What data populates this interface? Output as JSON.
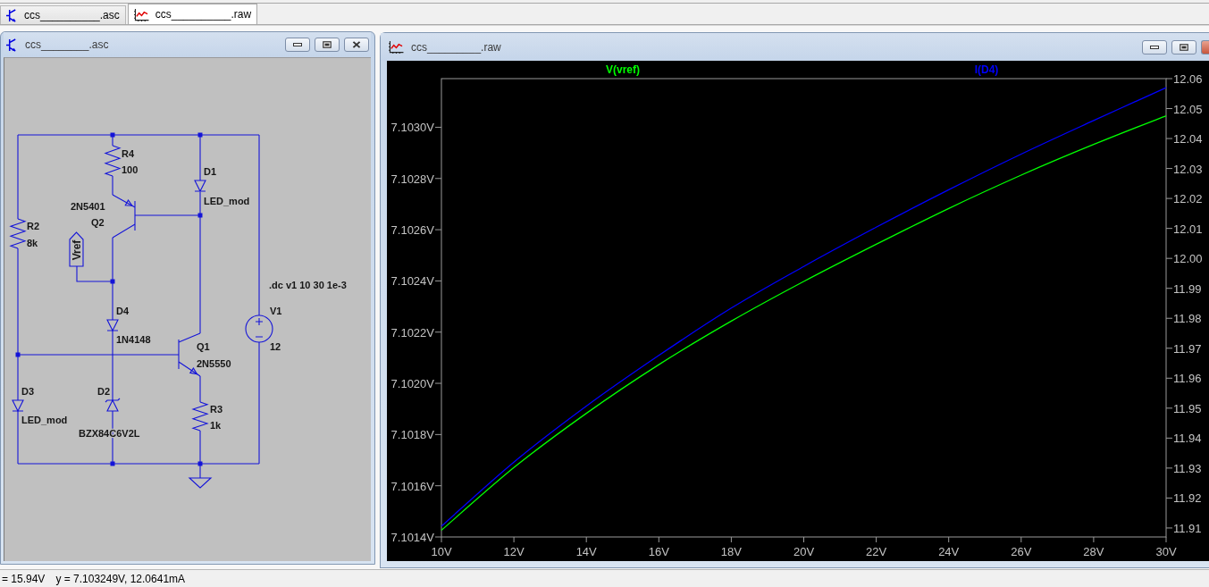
{
  "tabs": [
    {
      "kind": "schematic",
      "label": "ccs__________.asc",
      "selected": false
    },
    {
      "kind": "waveform",
      "label": "ccs__________.raw",
      "selected": true
    }
  ],
  "schematic_window": {
    "title": "ccs________.asc",
    "components": [
      {
        "kind": "resistor",
        "ref": "R4",
        "value": "100"
      },
      {
        "kind": "diode",
        "ref": "D1",
        "value": "LED_mod"
      },
      {
        "kind": "pnp",
        "ref": "Q2",
        "value": "2N5401"
      },
      {
        "kind": "resistor",
        "ref": "R2",
        "value": "8k"
      },
      {
        "kind": "diode",
        "ref": "D4",
        "value": "1N4148"
      },
      {
        "kind": "source",
        "ref": "V1",
        "value": "12"
      },
      {
        "kind": "npn",
        "ref": "Q1",
        "value": "2N5550"
      },
      {
        "kind": "diode",
        "ref": "D3",
        "value": "LED_mod"
      },
      {
        "kind": "zener",
        "ref": "D2",
        "value": "BZX84C6V2L"
      },
      {
        "kind": "resistor",
        "ref": "R3",
        "value": "1k"
      }
    ],
    "net_label": "Vref",
    "directive": ".dc v1 10 30 1e-3"
  },
  "plot_window": {
    "title": "ccs_________.raw",
    "chart_data": {
      "type": "line",
      "x": [
        10,
        12,
        14,
        16,
        18,
        20,
        22,
        24,
        26,
        28,
        30
      ],
      "xlim": [
        10,
        30
      ],
      "ylim": [
        7.1014,
        7.10319
      ],
      "y2lim": [
        11.907,
        12.06
      ],
      "xticks": [
        {
          "value": 10,
          "label": "10V"
        },
        {
          "value": 12,
          "label": "12V"
        },
        {
          "value": 14,
          "label": "14V"
        },
        {
          "value": 16,
          "label": "16V"
        },
        {
          "value": 18,
          "label": "18V"
        },
        {
          "value": 20,
          "label": "20V"
        },
        {
          "value": 22,
          "label": "22V"
        },
        {
          "value": 24,
          "label": "24V"
        },
        {
          "value": 26,
          "label": "26V"
        },
        {
          "value": 28,
          "label": "28V"
        },
        {
          "value": 30,
          "label": "30V"
        }
      ],
      "yticks": [
        {
          "value": 7.1014,
          "label": "7.1014V"
        },
        {
          "value": 7.1016,
          "label": "7.1016V"
        },
        {
          "value": 7.1018,
          "label": "7.1018V"
        },
        {
          "value": 7.102,
          "label": "7.1020V"
        },
        {
          "value": 7.1022,
          "label": "7.1022V"
        },
        {
          "value": 7.1024,
          "label": "7.1024V"
        },
        {
          "value": 7.1026,
          "label": "7.1026V"
        },
        {
          "value": 7.1028,
          "label": "7.1028V"
        },
        {
          "value": 7.103,
          "label": "7.1030V"
        }
      ],
      "y2ticks": [
        {
          "value": 11.91,
          "label": "11.91"
        },
        {
          "value": 11.92,
          "label": "11.92"
        },
        {
          "value": 11.93,
          "label": "11.93"
        },
        {
          "value": 11.94,
          "label": "11.94"
        },
        {
          "value": 11.95,
          "label": "11.95"
        },
        {
          "value": 11.96,
          "label": "11.96"
        },
        {
          "value": 11.97,
          "label": "11.97"
        },
        {
          "value": 11.98,
          "label": "11.98"
        },
        {
          "value": 11.99,
          "label": "11.99"
        },
        {
          "value": 12.0,
          "label": "12.00"
        },
        {
          "value": 12.01,
          "label": "12.01"
        },
        {
          "value": 12.02,
          "label": "12.02"
        },
        {
          "value": 12.03,
          "label": "12.03"
        },
        {
          "value": 12.04,
          "label": "12.04"
        },
        {
          "value": 12.05,
          "label": "12.05"
        },
        {
          "value": 12.06,
          "label": "12.06"
        }
      ],
      "series": [
        {
          "name": "V(vref)",
          "color": "#00ff00",
          "values": [
            7.101426,
            7.101671,
            7.101883,
            7.102073,
            7.102243,
            7.102398,
            7.102543,
            7.102683,
            7.102813,
            7.102933,
            7.103045
          ]
        },
        {
          "name": "I(D4)",
          "color": "#0000ff",
          "axis": "y2",
          "values": [
            11.9106,
            11.932,
            11.9507,
            11.9676,
            11.9834,
            11.9973,
            12.0104,
            12.0229,
            12.0348,
            12.046,
            12.057
          ]
        }
      ]
    }
  },
  "status_bar": {
    "x_readout": "= 15.94V",
    "y_readout": "y = 7.103249V, 12.0641mA"
  }
}
